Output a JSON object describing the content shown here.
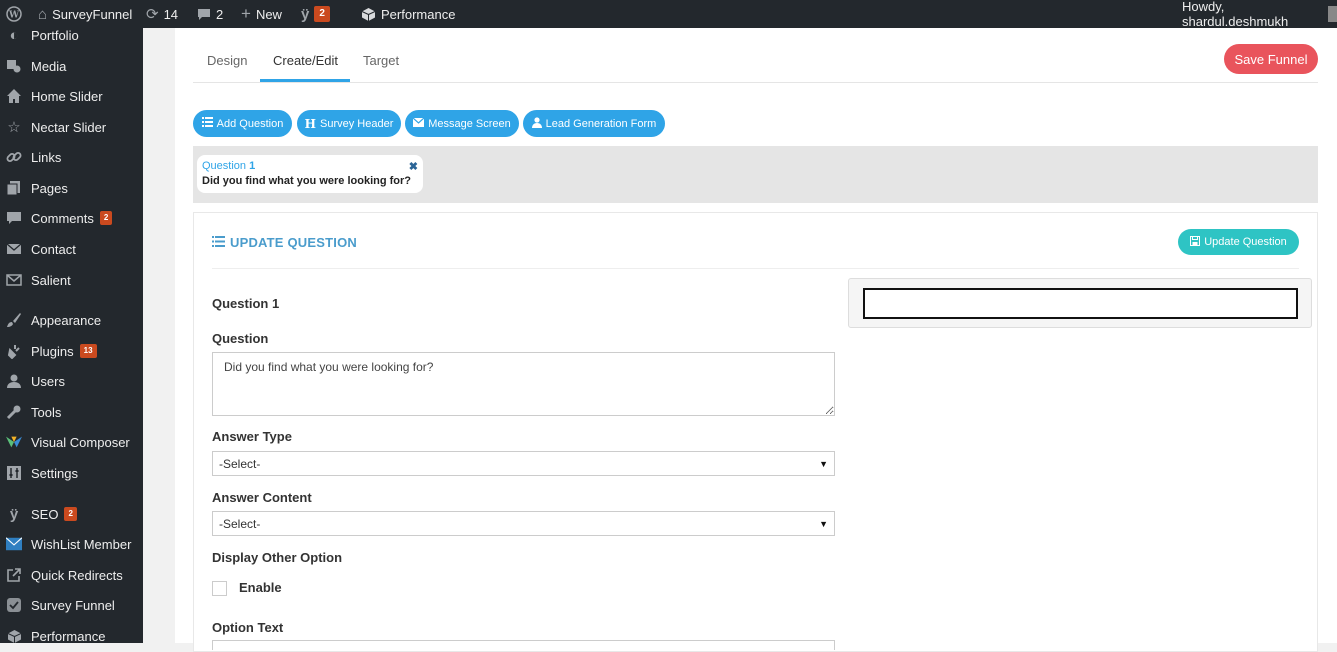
{
  "adminbar": {
    "site_name": "SurveyFunnel",
    "updates_count": "14",
    "comments_count": "2",
    "new_label": "New",
    "seo_count": "2",
    "performance_label": "Performance",
    "howdy": "Howdy, shardul.deshmukh"
  },
  "sidebar": {
    "items": [
      {
        "label": "Portfolio",
        "icon": "portfolio-icon"
      },
      {
        "label": "Media",
        "icon": "media-icon"
      },
      {
        "label": "Home Slider",
        "icon": "home-icon"
      },
      {
        "label": "Nectar Slider",
        "icon": "star-icon"
      },
      {
        "label": "Links",
        "icon": "link-icon"
      },
      {
        "label": "Pages",
        "icon": "pages-icon"
      },
      {
        "label": "Comments",
        "icon": "comment-icon",
        "badge": "2"
      },
      {
        "label": "Contact",
        "icon": "mail-icon"
      },
      {
        "label": "Salient",
        "icon": "envelope-icon"
      },
      {
        "label": "Appearance",
        "icon": "brush-icon"
      },
      {
        "label": "Plugins",
        "icon": "plugin-icon",
        "badge": "13"
      },
      {
        "label": "Users",
        "icon": "user-icon"
      },
      {
        "label": "Tools",
        "icon": "wrench-icon"
      },
      {
        "label": "Visual Composer",
        "icon": "vc-icon"
      },
      {
        "label": "Settings",
        "icon": "settings-icon"
      },
      {
        "label": "SEO",
        "icon": "yoast-icon",
        "badge": "2"
      },
      {
        "label": "WishList Member",
        "icon": "wishlist-icon"
      },
      {
        "label": "Quick Redirects",
        "icon": "external-link-icon"
      },
      {
        "label": "Survey Funnel",
        "icon": "survey-icon"
      },
      {
        "label": "Performance",
        "icon": "performance-icon"
      }
    ]
  },
  "tabs": [
    {
      "label": "Design"
    },
    {
      "label": "Create/Edit"
    },
    {
      "label": "Target"
    }
  ],
  "save_funnel": "Save Funnel",
  "toolbar": {
    "add_question": "Add Question",
    "survey_header": "Survey Header",
    "message_screen": "Message Screen",
    "lead_form": "Lead Generation Form"
  },
  "question_card": {
    "label": "Question",
    "number": "1",
    "text": "Did you find what you were looking for?",
    "close": "✖"
  },
  "panel": {
    "title": "UPDATE QUESTION",
    "update_button": "Update Question",
    "question_heading": "Question 1",
    "question_label": "Question",
    "question_value": "Did you find what you were looking for?",
    "answer_type_label": "Answer Type",
    "answer_type_value": "-Select-",
    "answer_content_label": "Answer Content",
    "answer_content_value": "-Select-",
    "display_other_label": "Display Other Option",
    "enable_label": "Enable",
    "option_text_label": "Option Text"
  },
  "colors": {
    "adminbar": "#23282d",
    "accent_blue": "#2fa4e7",
    "save_red": "#e9545c",
    "update_teal": "#2ec4c4",
    "badge": "#ca4a1f"
  }
}
